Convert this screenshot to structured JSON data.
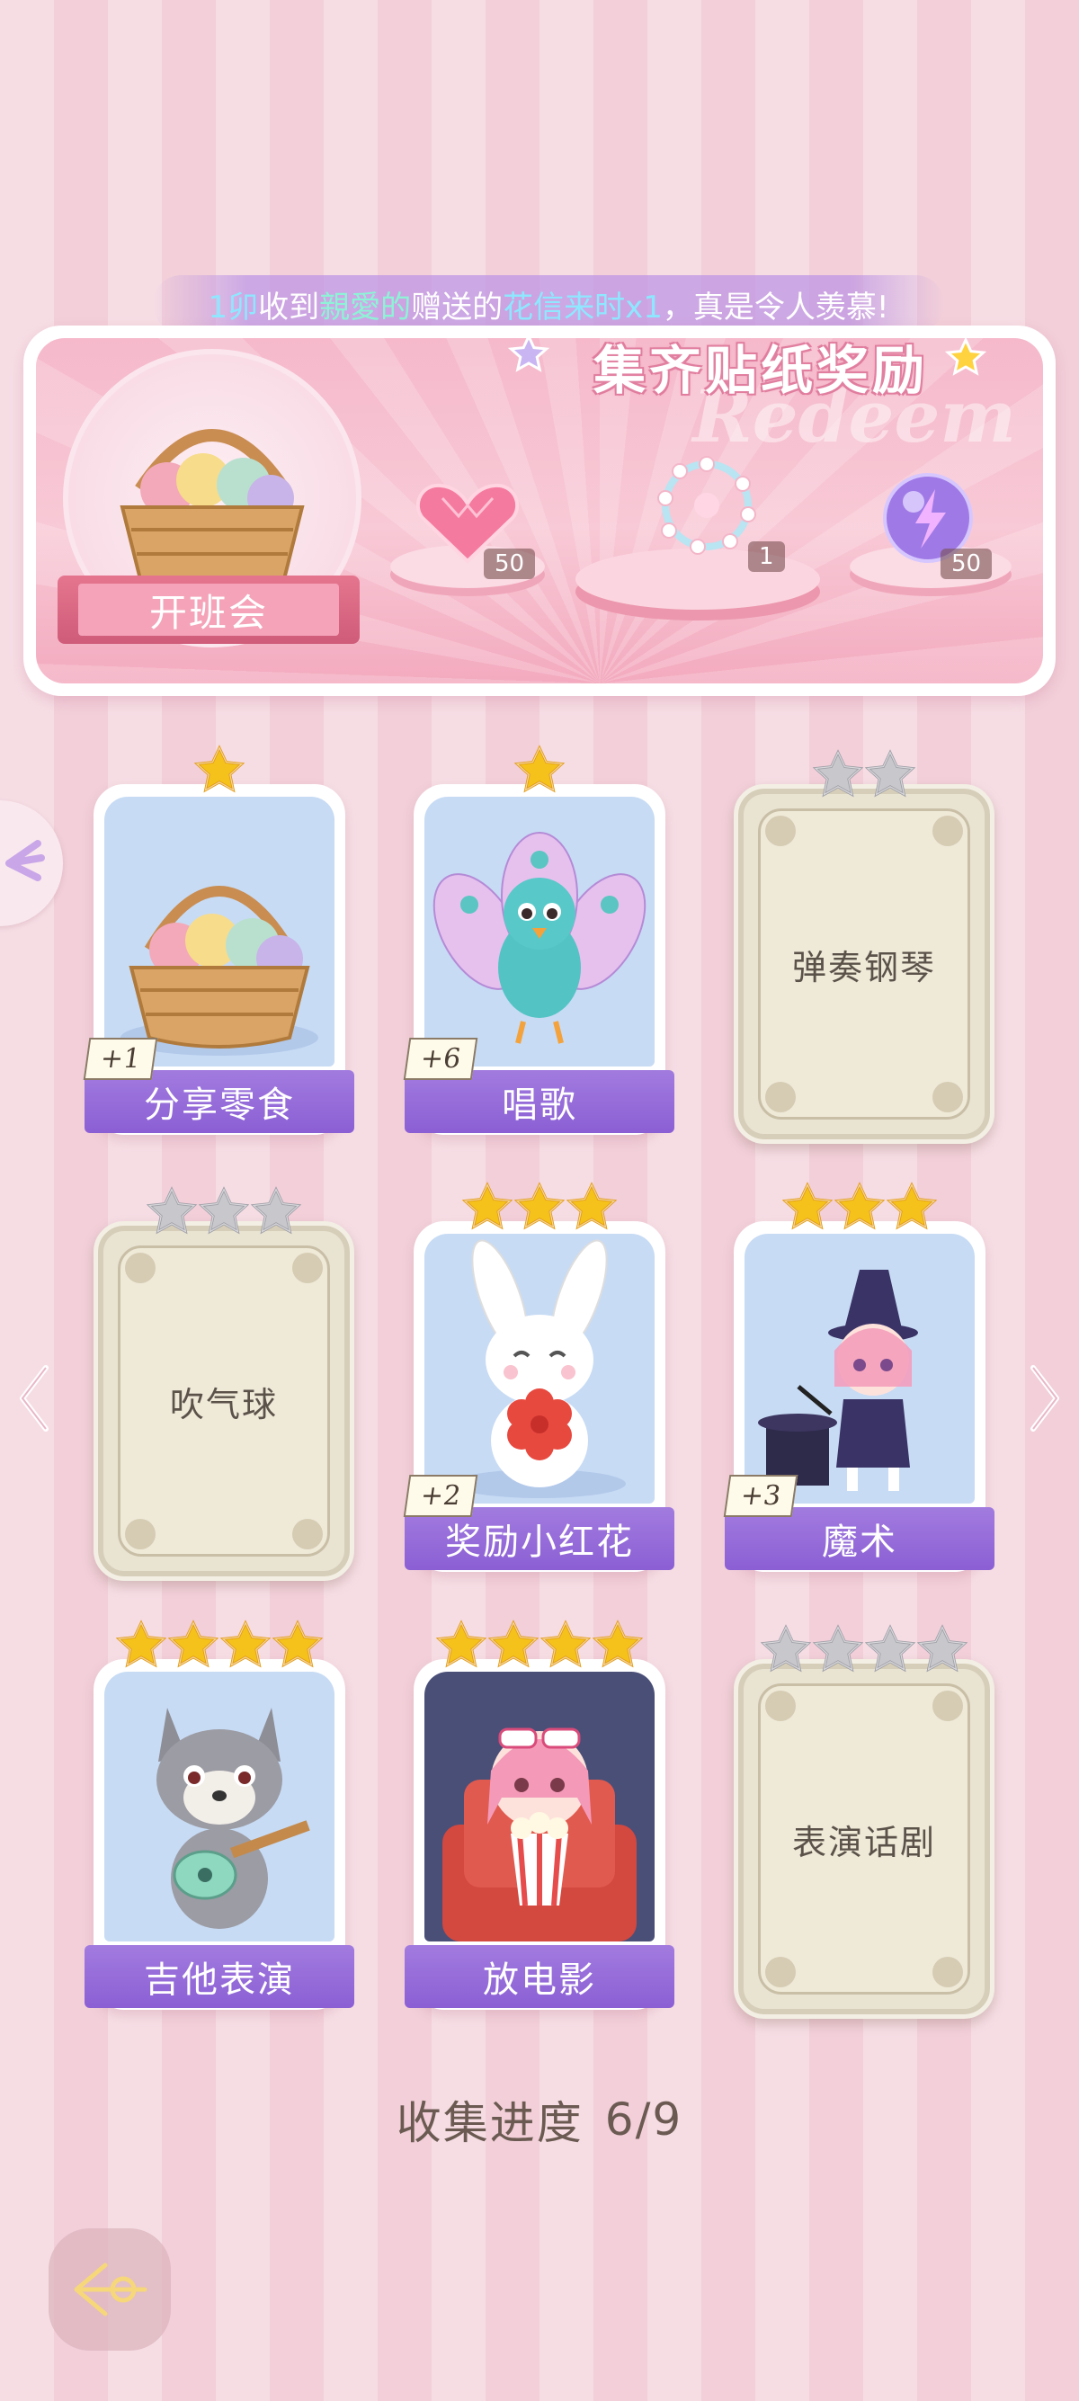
{
  "marquee": {
    "prefix": "1卯",
    "received": "收到",
    "sender": "親愛的",
    "sent": "赠送的",
    "gift": "花信来时x1",
    "suffix": "，真是令人羡慕!"
  },
  "banner": {
    "title": "集齐贴纸奖励",
    "watermark": "Redeem",
    "event_label": "开班会",
    "rewards": [
      {
        "icon": "pink-heart-gem-icon",
        "count": "50"
      },
      {
        "icon": "crystal-bracelet-icon",
        "count": "1"
      },
      {
        "icon": "lightning-orb-icon",
        "count": "50"
      }
    ]
  },
  "cards": [
    {
      "name": "分享零食",
      "stars": 1,
      "max_stars": 1,
      "locked": false,
      "bonus": "+1",
      "art": "snack-basket"
    },
    {
      "name": "唱歌",
      "stars": 1,
      "max_stars": 1,
      "locked": false,
      "bonus": "+6",
      "art": "peacock-singer"
    },
    {
      "name": "弹奏钢琴",
      "stars": 0,
      "max_stars": 2,
      "locked": true,
      "bonus": "",
      "art": ""
    },
    {
      "name": "吹气球",
      "stars": 0,
      "max_stars": 3,
      "locked": true,
      "bonus": "",
      "art": ""
    },
    {
      "name": "奖励小红花",
      "stars": 3,
      "max_stars": 3,
      "locked": false,
      "bonus": "+2",
      "art": "bunny-flower"
    },
    {
      "name": "魔术",
      "stars": 3,
      "max_stars": 3,
      "locked": false,
      "bonus": "+3",
      "art": "magician-girl"
    },
    {
      "name": "吉他表演",
      "stars": 4,
      "max_stars": 4,
      "locked": false,
      "bonus": "",
      "art": "wolf-guitar"
    },
    {
      "name": "放电影",
      "stars": 4,
      "max_stars": 4,
      "locked": false,
      "bonus": "",
      "art": "movie-girl"
    },
    {
      "name": "表演话剧",
      "stars": 0,
      "max_stars": 4,
      "locked": true,
      "bonus": "",
      "art": ""
    }
  ],
  "progress": {
    "label": "收集进度",
    "value": "6/9"
  },
  "colors": {
    "card_label": "#8b5fd4",
    "star_gold": "#f5c21b",
    "star_grey": "#c8c8cc"
  }
}
